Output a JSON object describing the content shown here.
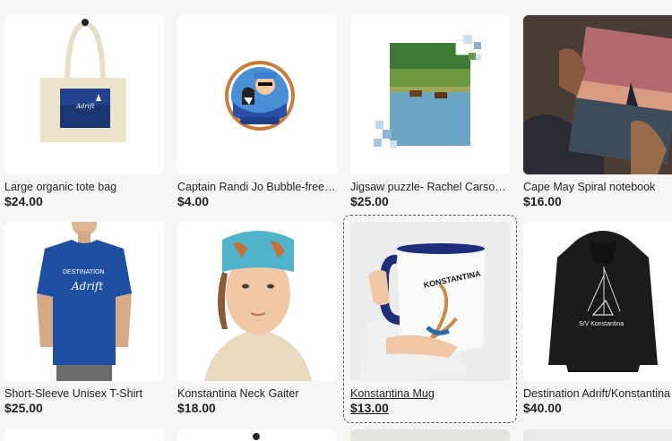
{
  "products": [
    {
      "title": "Large organic tote bag",
      "price": "$24.00",
      "icon": "tote-bag-image"
    },
    {
      "title": "Captain Randi Jo Bubble-free s...",
      "price": "$4.00",
      "icon": "sticker-image"
    },
    {
      "title": "Jigsaw puzzle- Rachel Carson ...",
      "price": "$25.00",
      "icon": "jigsaw-puzzle-image"
    },
    {
      "title": "Cape May Spiral notebook",
      "price": "$16.00",
      "icon": "notebook-image"
    },
    {
      "title": "Short-Sleeve Unisex T-Shirt",
      "price": "$25.00",
      "icon": "tshirt-image",
      "print_text": "DESTINATION",
      "print_script": "Adrift"
    },
    {
      "title": "Konstantina Neck Gaiter",
      "price": "$18.00",
      "icon": "neck-gaiter-image"
    },
    {
      "title": "Konstantina Mug",
      "price": "$13.00",
      "icon": "mug-image",
      "print_text": "KONSTANTINA"
    },
    {
      "title": "Destination Adrift/Konstantina ...",
      "price": "$40.00",
      "icon": "hoodie-image",
      "print_text": "S/V Konstantina"
    }
  ],
  "colors": {
    "page_bg": "#f7f6f4",
    "text": "#222222",
    "tshirt": "#1f4fa0",
    "hoodie": "#1b1b1b",
    "gaiter": "#4fb3c9"
  }
}
